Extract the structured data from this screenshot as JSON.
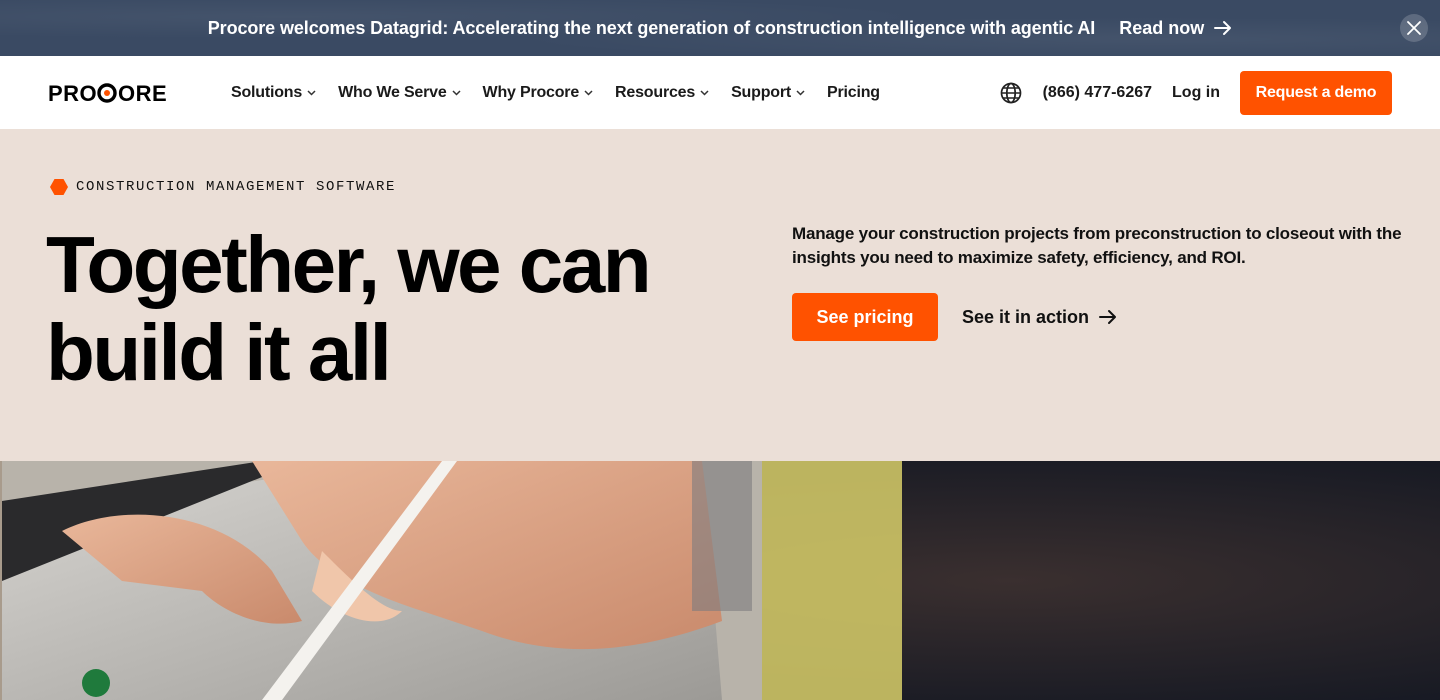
{
  "banner": {
    "text": "Procore welcomes Datagrid: Accelerating the next generation of construction intelligence with agentic AI",
    "link_label": "Read now",
    "close_icon": "close-icon"
  },
  "nav": {
    "logo_text": "PROCORE",
    "menu": [
      {
        "label": "Solutions",
        "has_dropdown": true
      },
      {
        "label": "Who We Serve",
        "has_dropdown": true
      },
      {
        "label": "Why Procore",
        "has_dropdown": true
      },
      {
        "label": "Resources",
        "has_dropdown": true
      },
      {
        "label": "Support",
        "has_dropdown": true
      },
      {
        "label": "Pricing",
        "has_dropdown": false
      }
    ],
    "globe_icon": "globe-icon",
    "phone": "(866) 477-6267",
    "login_label": "Log in",
    "demo_label": "Request a demo"
  },
  "hero": {
    "eyebrow": "CONSTRUCTION MANAGEMENT SOFTWARE",
    "headline_line1": "Together, we can",
    "headline_line2": "build it all",
    "description": "Manage your construction projects from preconstruction to closeout with the insights you need to maximize safety, efficiency, and ROI.",
    "primary_cta": "See pricing",
    "secondary_cta": "See it in action"
  },
  "colors": {
    "brand_orange": "#ff5200",
    "banner_bg": "#3a4a63",
    "hero_bg": "#ebdfd7"
  }
}
